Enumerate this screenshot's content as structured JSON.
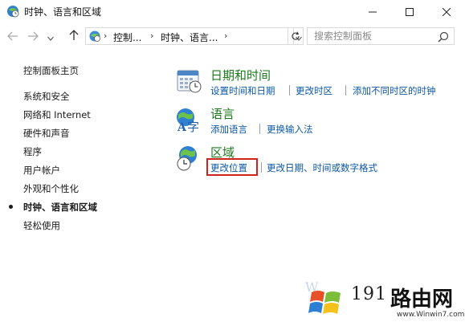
{
  "window": {
    "title": "时钟、语言和区域",
    "controls": {
      "minimize_icon": "minimize-icon",
      "maximize_icon": "maximize-icon",
      "close_icon": "close-icon"
    }
  },
  "address_bar": {
    "crumbs": [
      "控制...",
      "时钟、语言..."
    ],
    "search_placeholder": "搜索控制面板"
  },
  "left_pane": {
    "home": "控制面板主页",
    "items": [
      "系统和安全",
      "网络和 Internet",
      "硬件和声音",
      "程序",
      "用户帐户",
      "外观和个性化",
      "时钟、语言和区域",
      "轻松使用"
    ],
    "current_index": 6
  },
  "categories": [
    {
      "title": "日期和时间",
      "icon": "date-time-icon",
      "tasks": [
        "设置时间和日期",
        "更改时区",
        "添加不同时区的时钟"
      ]
    },
    {
      "title": "语言",
      "icon": "language-icon",
      "tasks": [
        "添加语言",
        "更换输入法"
      ]
    },
    {
      "title": "区域",
      "icon": "region-globe-icon",
      "tasks": [
        "更改位置",
        "更改日期、时间或数字格式"
      ]
    }
  ],
  "highlighted_task": "更改位置",
  "watermark": {
    "number": "191",
    "brand": "路由网",
    "url": "www.Winwin7.com",
    "small": "W"
  },
  "colors": {
    "category_title": "#1a7a1a",
    "link": "#0b57a4",
    "highlight_box": "#d0231b"
  }
}
